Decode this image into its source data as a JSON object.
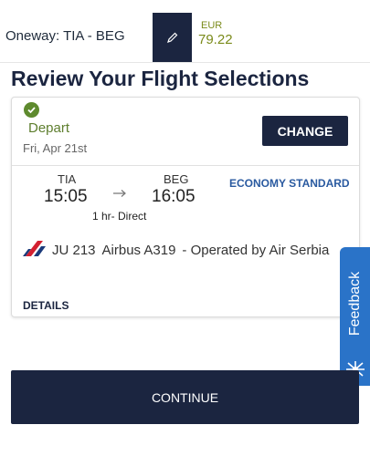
{
  "header": {
    "route": "Oneway: TIA - BEG",
    "currency": "EUR",
    "price": "79.22",
    "edit_icon": "pencil-icon"
  },
  "title": "Review Your Flight Selections",
  "flight": {
    "status_icon": "check-circle-icon",
    "label": "Depart",
    "date": "Fri, Apr 21st",
    "change_label": "CHANGE",
    "origin_code": "TIA",
    "origin_time": "15:05",
    "dest_code": "BEG",
    "dest_time": "16:05",
    "duration": "1 hr- Direct",
    "fare_class": "ECONOMY STANDARD",
    "flight_number": "JU 213",
    "aircraft": "Airbus A319",
    "operated_by": "- Operated by Air Serbia",
    "details_label": "DETAILS",
    "airline_logo": "air-serbia-logo"
  },
  "feedback_label": "Feedback",
  "continue_label": "CONTINUE",
  "colors": {
    "navy": "#1b2540",
    "price_olive": "#7a8a1a",
    "depart_green": "#5e7e2e",
    "fare_blue": "#2a5aa0",
    "feedback_blue": "#2a73c8"
  }
}
